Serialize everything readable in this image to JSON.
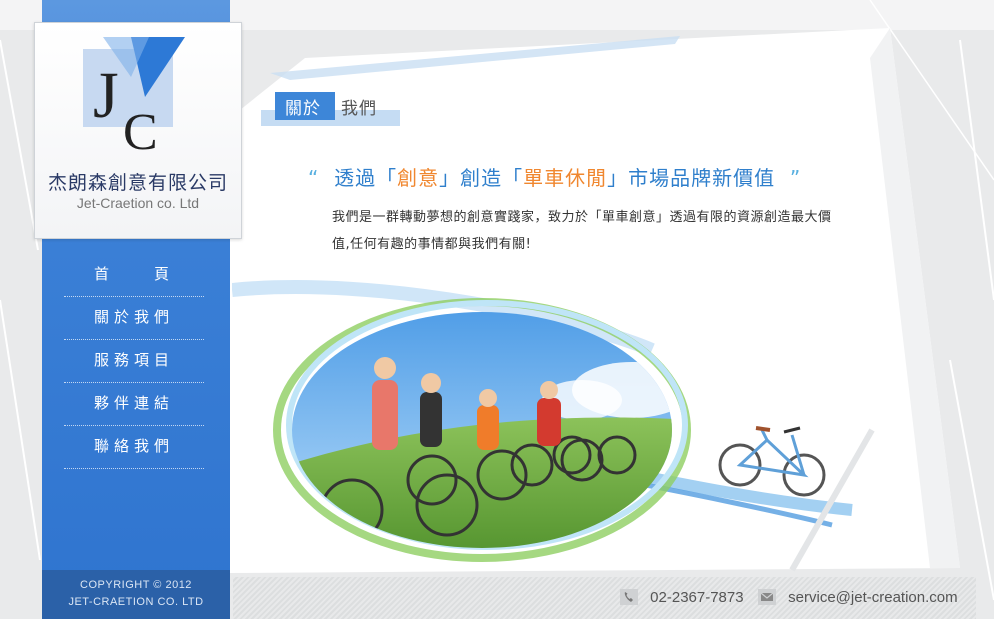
{
  "brand": {
    "logo_letters": "JC",
    "company_cn": "杰朗森創意有限公司",
    "company_en": "Jet-Craetion co. Ltd"
  },
  "nav": {
    "items": [
      {
        "label": "首　　頁"
      },
      {
        "label": "關於我們"
      },
      {
        "label": "服務項目"
      },
      {
        "label": "夥伴連結"
      },
      {
        "label": "聯絡我們"
      }
    ]
  },
  "copyright": {
    "line1": "COPYRIGHT © 2012",
    "line2": "JET-CRAETION CO. LTD"
  },
  "section": {
    "title_box": "關於",
    "title_rest": "我們"
  },
  "slogan": {
    "open_quote": "“",
    "part1": "透過「",
    "hl1": "創意",
    "part2": "」創造「",
    "hl2": "單車休閒",
    "part3": "」市場品牌新價值",
    "close_quote": "”"
  },
  "description": "我們是一群轉動夢想的創意實踐家，致力於「單車創意」透過有限的資源創造最大價值,任何有趣的事情都與我們有關!",
  "contact": {
    "phone": "02-2367-7873",
    "email": "service@jet-creation.com"
  },
  "colors": {
    "sidebar_blue": "#3a7fd6",
    "accent_orange": "#f0872f",
    "slogan_blue": "#2f7fcc"
  }
}
